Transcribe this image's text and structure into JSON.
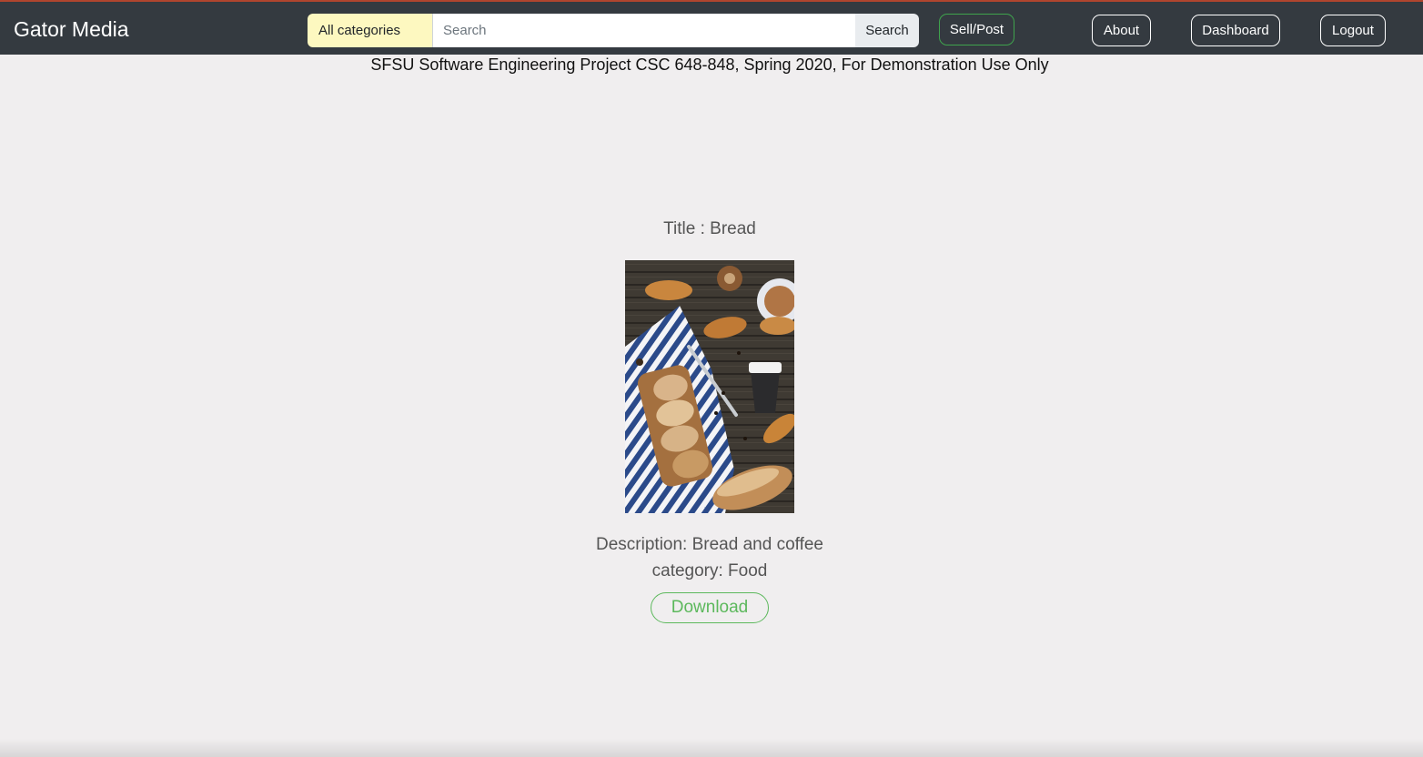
{
  "navbar": {
    "brand": "Gator Media",
    "category_select": "All categories",
    "search_placeholder": "Search",
    "search_button": "Search",
    "sell_button": "Sell/Post",
    "about_button": "About",
    "dashboard_button": "Dashboard",
    "logout_button": "Logout"
  },
  "banner": {
    "disclaimer": "SFSU Software Engineering Project CSC 648-848, Spring 2020, For Demonstration Use Only"
  },
  "item": {
    "title": "Title : Bread",
    "image_alt": "Bread and coffee",
    "description": "Description: Bread and coffee",
    "category": "category: Food",
    "download_button": "Download"
  },
  "colors": {
    "navbar_bg": "#343a40",
    "page_bg": "#f0eeef",
    "category_bg": "#fdf8c0",
    "sell_border": "#3fa34d",
    "download_accent": "#5cb85c"
  }
}
